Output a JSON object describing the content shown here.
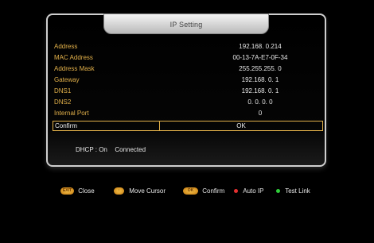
{
  "title": "IP Setting",
  "rows": [
    {
      "label": "Address",
      "value": "192.168.  0.214"
    },
    {
      "label": "MAC Address",
      "value": "00-13-7A-E7-0F-34"
    },
    {
      "label": "Address Mask",
      "value": "255.255.255.  0"
    },
    {
      "label": "Gateway",
      "value": "192.168.  0.  1"
    },
    {
      "label": "DNS1",
      "value": "192.168.  0.  1"
    },
    {
      "label": "DNS2",
      "value": "0.  0.  0.  0"
    },
    {
      "label": "Internal Port",
      "value": "0"
    }
  ],
  "confirm": {
    "label": "Confirm",
    "value": "OK"
  },
  "status": {
    "dhcp_label": "DHCP : On",
    "connection": "Connected"
  },
  "legend": {
    "exit_key": "EXIT",
    "close": "Close",
    "move_cursor": "Move Cursor",
    "ok_key": "OK",
    "confirm": "Confirm",
    "auto_ip": "Auto IP",
    "test_link": "Test Link"
  },
  "colors": {
    "accent": "#e3b14a",
    "red": "#e53030",
    "green": "#2fcf3a"
  }
}
